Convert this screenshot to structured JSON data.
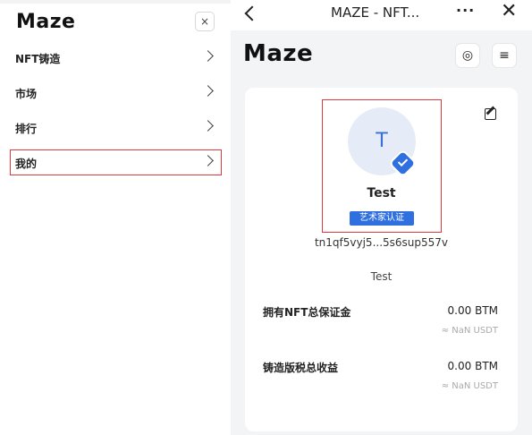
{
  "drawer": {
    "logo": "Maze",
    "close_glyph": "×",
    "items": [
      {
        "label": "NFT铸造"
      },
      {
        "label": "市场"
      },
      {
        "label": "排行"
      },
      {
        "label": "我的"
      }
    ],
    "active_index": 3
  },
  "topbar": {
    "title": "MAZE - NFT...",
    "more_glyph": "···",
    "close_glyph": "✕"
  },
  "header": {
    "logo": "Maze",
    "palette_icon": "◎",
    "menu_icon": "≡"
  },
  "profile": {
    "avatar_letter": "T",
    "name": "Test",
    "tag": "艺术家认证",
    "address": "tn1qf5vyj5...5s6sup557v",
    "bio": "Test"
  },
  "stats": [
    {
      "label": "拥有NFT总保证金",
      "value": "0.00 BTM",
      "sub": "≈ NaN USDT"
    },
    {
      "label": "铸造版税总收益",
      "value": "0.00 BTM",
      "sub": "≈ NaN USDT"
    }
  ],
  "colors": {
    "accent": "#2f6fe0",
    "highlight": "#e0393e"
  }
}
